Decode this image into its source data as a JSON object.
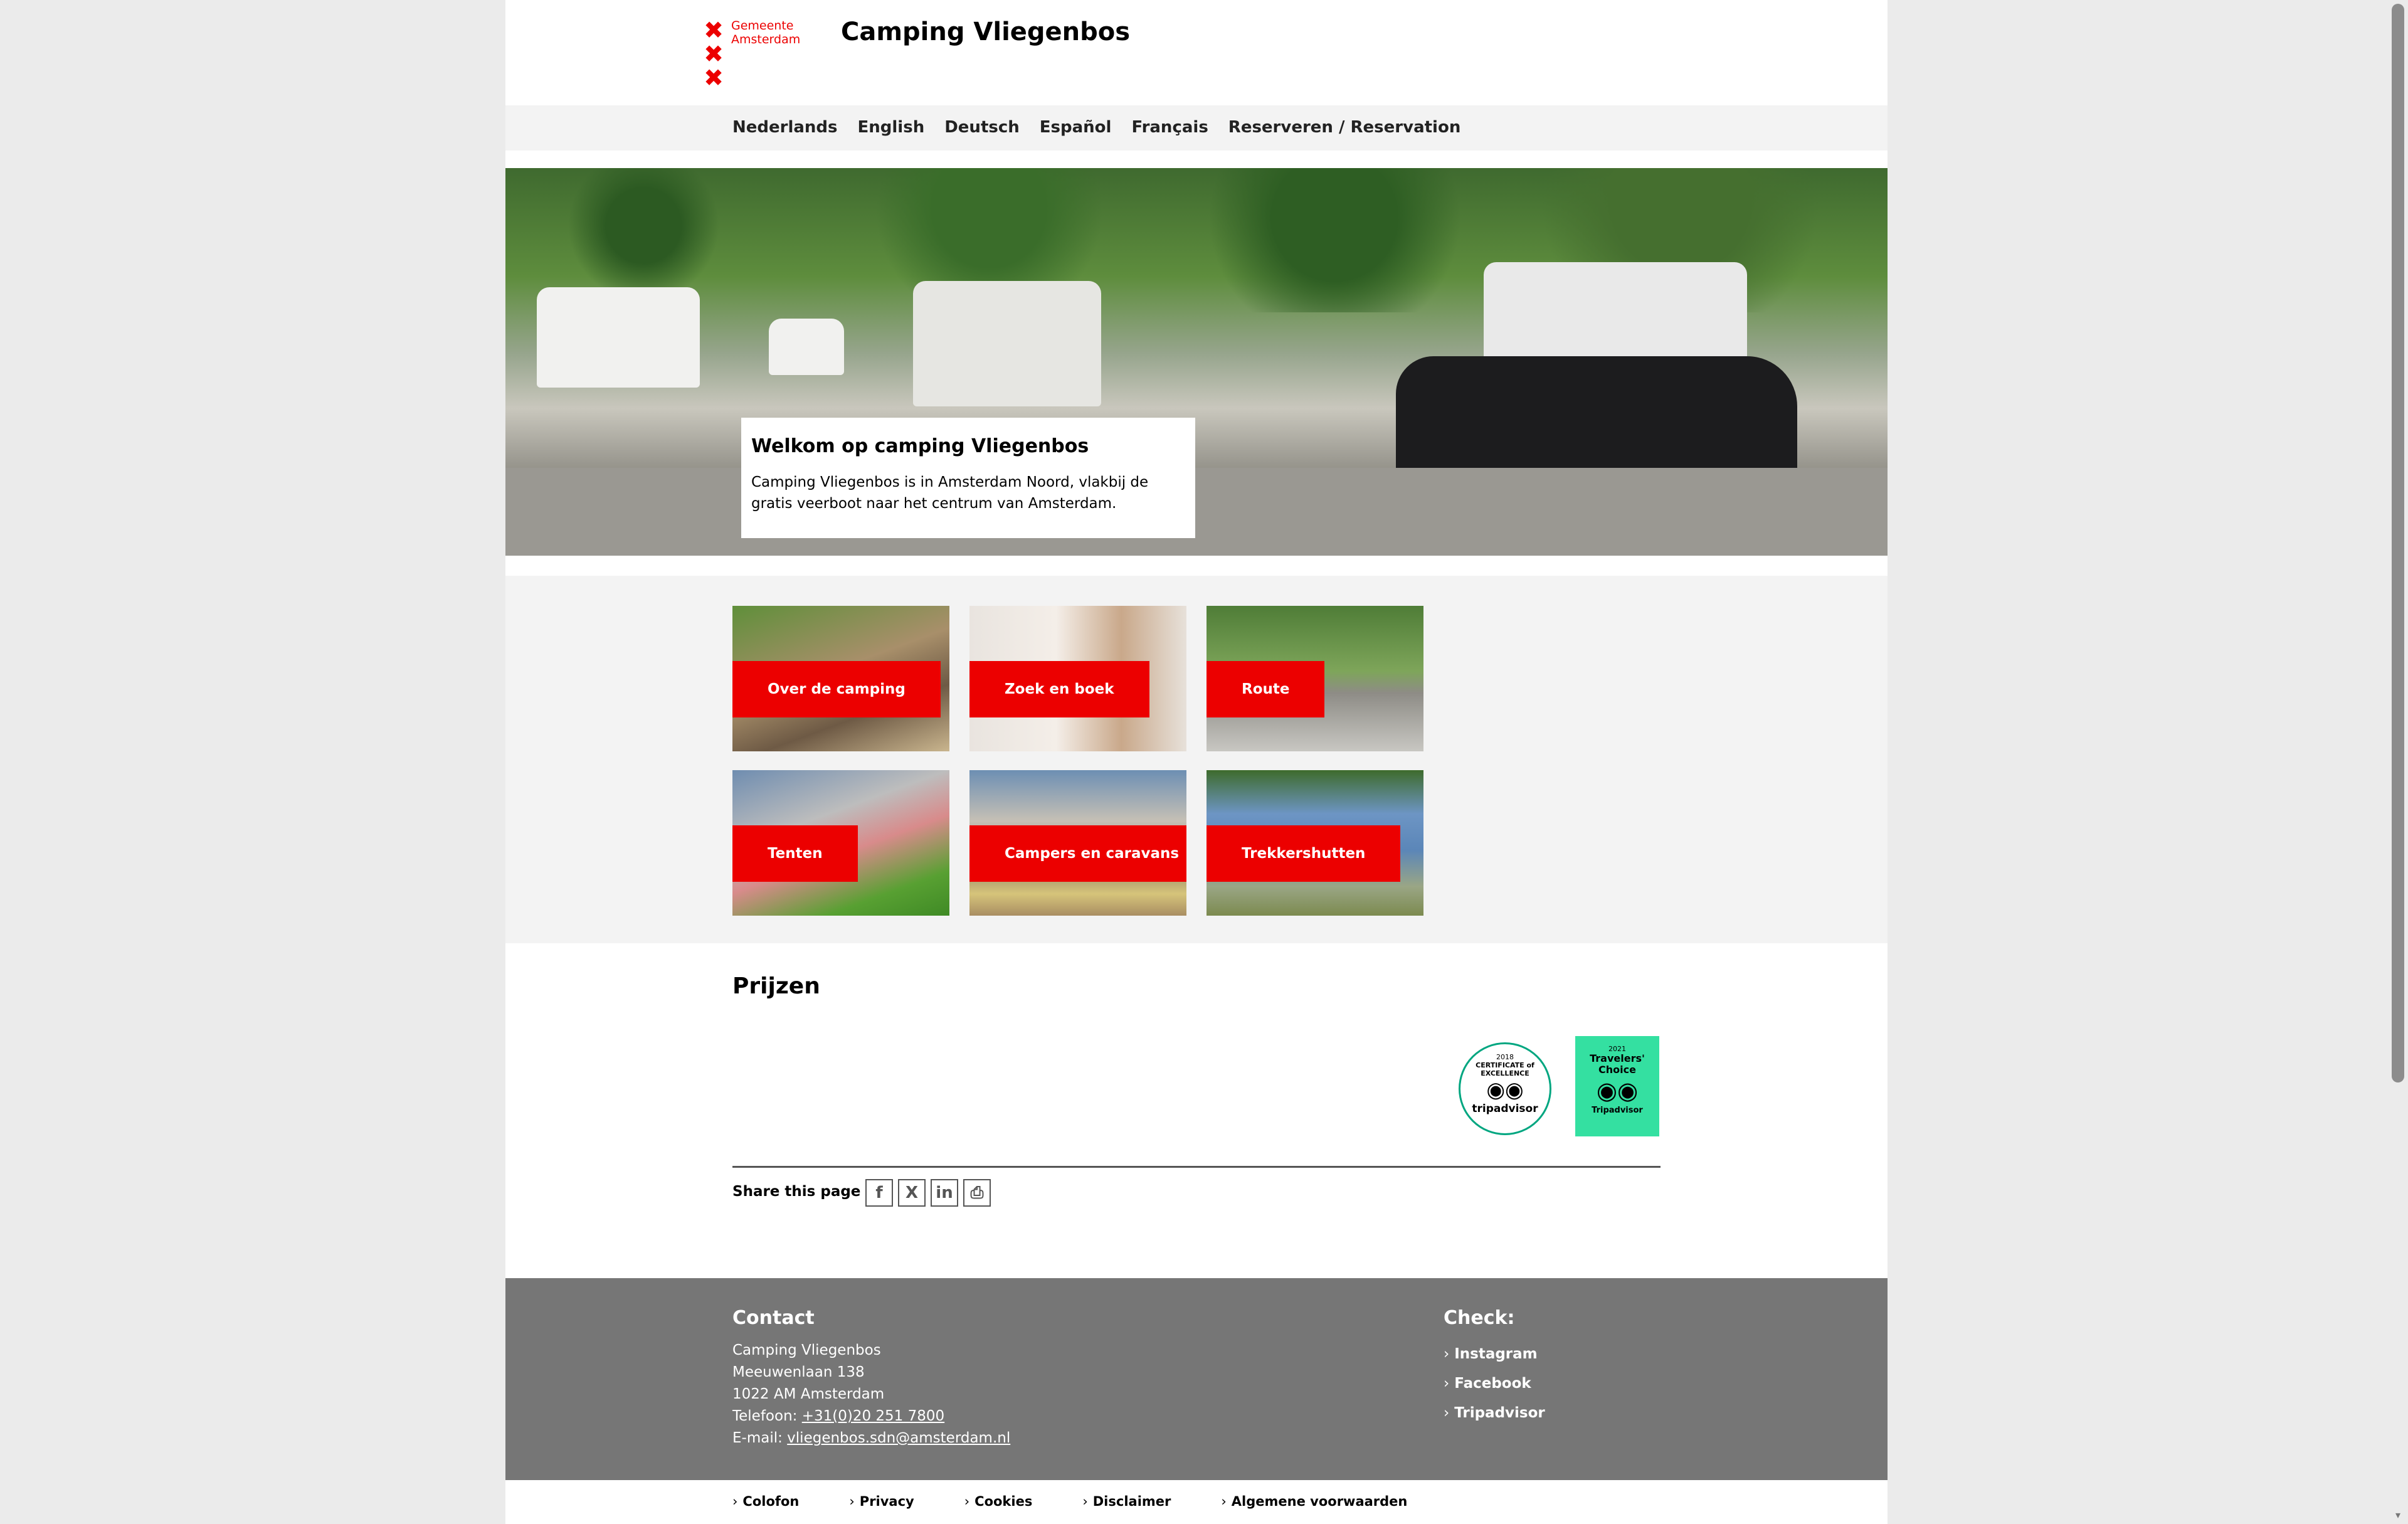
{
  "header": {
    "logo_text_line1": "Gemeente",
    "logo_text_line2": "Amsterdam",
    "site_title": "Camping Vliegenbos"
  },
  "nav": {
    "items": [
      "Nederlands",
      "English",
      "Deutsch",
      "Español",
      "Français",
      "Reserveren / Reservation"
    ]
  },
  "hero": {
    "title": "Welkom op camping Vliegenbos",
    "text": "Camping Vliegenbos is in Amsterdam Noord, vlakbij de gratis veerboot naar het centrum van Amsterdam."
  },
  "tiles": [
    {
      "label": "Over de camping"
    },
    {
      "label": "Zoek en boek"
    },
    {
      "label": "Route"
    },
    {
      "label": "Tenten"
    },
    {
      "label": "Campers en caravans"
    },
    {
      "label": "Trekkershutten"
    }
  ],
  "prices": {
    "title": "Prijzen",
    "badge1": {
      "year": "2018",
      "line1": "CERTIFICATE of",
      "line2": "EXCELLENCE",
      "brand": "tripadvisor"
    },
    "badge2": {
      "year": "2021",
      "line1": "Travelers'",
      "line2": "Choice",
      "brand": "Tripadvisor"
    }
  },
  "share": {
    "label": "Share this page",
    "icons": [
      "facebook-icon",
      "x-icon",
      "linkedin-icon",
      "print-icon"
    ]
  },
  "footer": {
    "contact_title": "Contact",
    "name": "Camping Vliegenbos",
    "street": "Meeuwenlaan 138",
    "city": "1022 AM Amsterdam",
    "phone_label": "Telefoon: ",
    "phone": "+31(0)20 251 7800",
    "email_label": "E-mail: ",
    "email": "vliegenbos.sdn@amsterdam.nl",
    "check_title": "Check:",
    "check_items": [
      "Instagram",
      "Facebook",
      "Tripadvisor"
    ]
  },
  "bottom_links": [
    "Colofon",
    "Privacy",
    "Cookies",
    "Disclaimer",
    "Algemene voorwaarden"
  ],
  "colors": {
    "accent": "#ec0000",
    "footer_bg": "#767676",
    "section_bg": "#f3f3f3",
    "tripadvisor_green": "#34e0a1"
  }
}
